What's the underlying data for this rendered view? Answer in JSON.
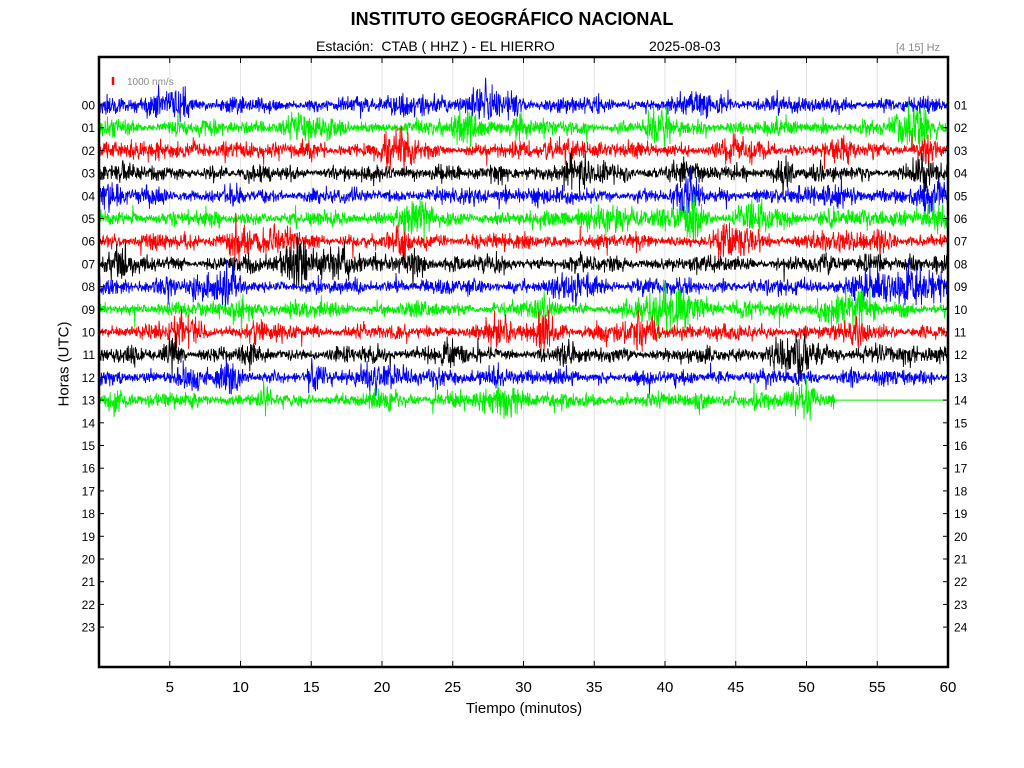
{
  "title": "INSTITUTO GEOGRÁFICO NACIONAL",
  "subtitle": "Estación:  CTAB ( HHZ ) - EL HIERRO",
  "date": "2025-08-03",
  "freq_band": "[4 15] Hz",
  "chart_data": {
    "type": "line",
    "title": "INSTITUTO GEOGRÁFICO NACIONAL",
    "xlabel": "Tiempo (minutos)",
    "ylabel": "Horas (UTC)",
    "xlim": [
      0,
      60
    ],
    "x_ticks": [
      5,
      10,
      15,
      20,
      25,
      30,
      35,
      40,
      45,
      50,
      55,
      60
    ],
    "left_tick_labels": [
      "00",
      "01",
      "02",
      "03",
      "04",
      "05",
      "06",
      "07",
      "08",
      "09",
      "10",
      "11",
      "12",
      "13",
      "14",
      "15",
      "16",
      "17",
      "18",
      "19",
      "20",
      "21",
      "22",
      "23"
    ],
    "right_tick_labels": [
      "01",
      "02",
      "03",
      "04",
      "05",
      "06",
      "07",
      "08",
      "09",
      "10",
      "11",
      "12",
      "13",
      "14",
      "15",
      "16",
      "17",
      "18",
      "19",
      "20",
      "21",
      "22",
      "23",
      "24"
    ],
    "grid": true,
    "scale_bar": {
      "label": "1000 nm/s",
      "color": "#ff0000"
    },
    "trace_colors": [
      "#0000ff",
      "#00ee00",
      "#ff0000",
      "#000000"
    ],
    "series": [
      {
        "hour": "00",
        "end_minute": 60
      },
      {
        "hour": "01",
        "end_minute": 60
      },
      {
        "hour": "02",
        "end_minute": 60
      },
      {
        "hour": "03",
        "end_minute": 60
      },
      {
        "hour": "04",
        "end_minute": 60
      },
      {
        "hour": "05",
        "end_minute": 60
      },
      {
        "hour": "06",
        "end_minute": 60
      },
      {
        "hour": "07",
        "end_minute": 60
      },
      {
        "hour": "08",
        "end_minute": 60
      },
      {
        "hour": "09",
        "end_minute": 60
      },
      {
        "hour": "10",
        "end_minute": 60
      },
      {
        "hour": "11",
        "end_minute": 60
      },
      {
        "hour": "12",
        "end_minute": 60
      },
      {
        "hour": "13",
        "end_minute": 52
      }
    ]
  }
}
